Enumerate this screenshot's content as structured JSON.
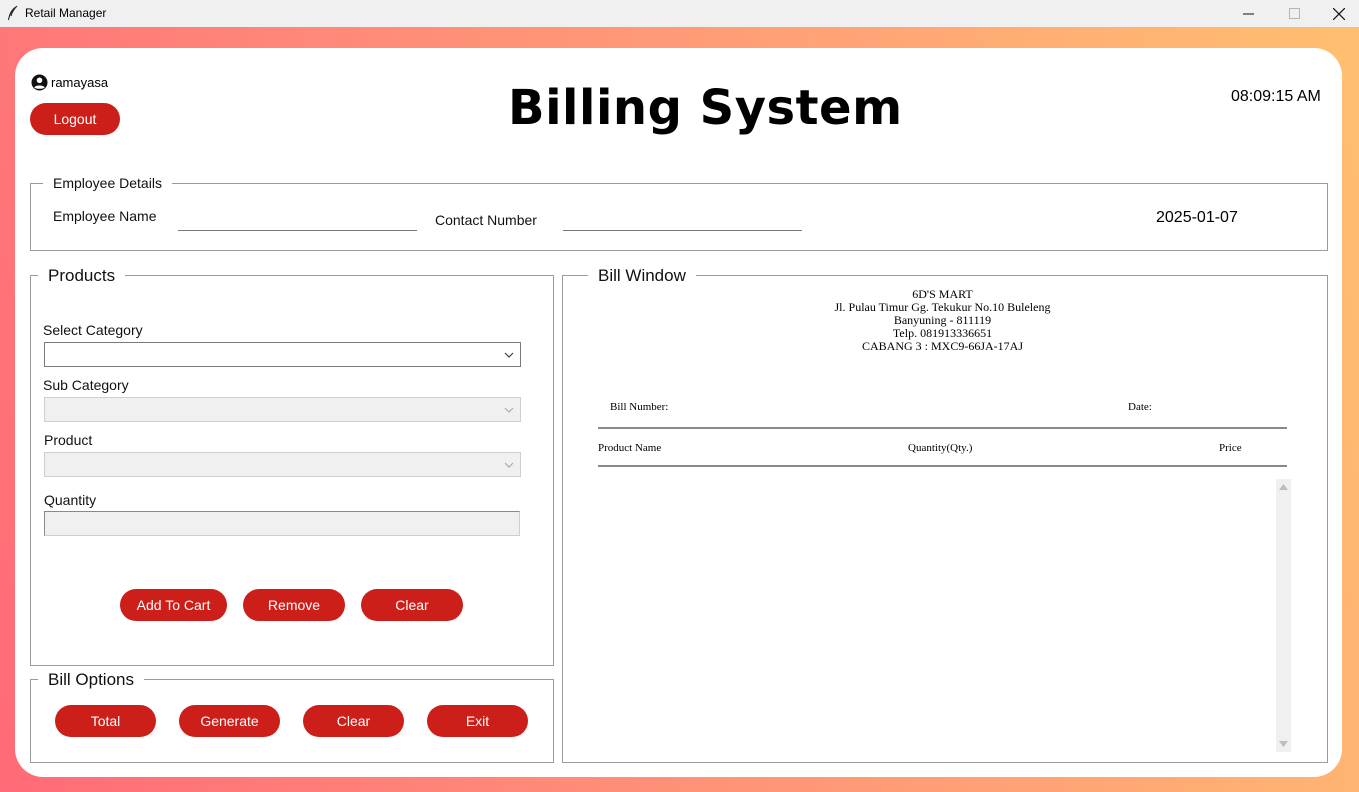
{
  "window": {
    "title": "Retail Manager"
  },
  "user": {
    "name": "ramayasa",
    "logout_label": "Logout"
  },
  "header": {
    "title": "Billing System",
    "time": "08:09:15 AM"
  },
  "employee": {
    "legend": "Employee Details",
    "name_label": "Employee Name",
    "name_value": "",
    "contact_label": "Contact Number",
    "contact_value": "",
    "date": "2025-01-07"
  },
  "products": {
    "legend": "Products",
    "category_label": "Select Category",
    "category_value": "",
    "subcategory_label": "Sub Category",
    "subcategory_value": "",
    "product_label": "Product",
    "product_value": "",
    "quantity_label": "Quantity",
    "quantity_value": "",
    "add_label": "Add To Cart",
    "remove_label": "Remove",
    "clear_label": "Clear"
  },
  "bill_options": {
    "legend": "Bill Options",
    "total_label": "Total",
    "generate_label": "Generate",
    "clear_label": "Clear",
    "exit_label": "Exit"
  },
  "bill_window": {
    "legend": "Bill Window",
    "store_lines": [
      "6D'S MART",
      "Jl. Pulau Timur Gg. Tekukur No.10 Buleleng",
      "Banyuning - 811119",
      "Telp. 081913336651",
      "CABANG 3 : MXC9-66JA-17AJ"
    ],
    "bill_number_label": "Bill Number:",
    "date_label": "Date:",
    "columns": [
      "Product Name",
      "Quantity(Qty.)",
      "Price"
    ]
  },
  "colors": {
    "accent": "#cc1f1a",
    "gradient_start": "#ff6b78",
    "gradient_end": "#ffbf70"
  }
}
